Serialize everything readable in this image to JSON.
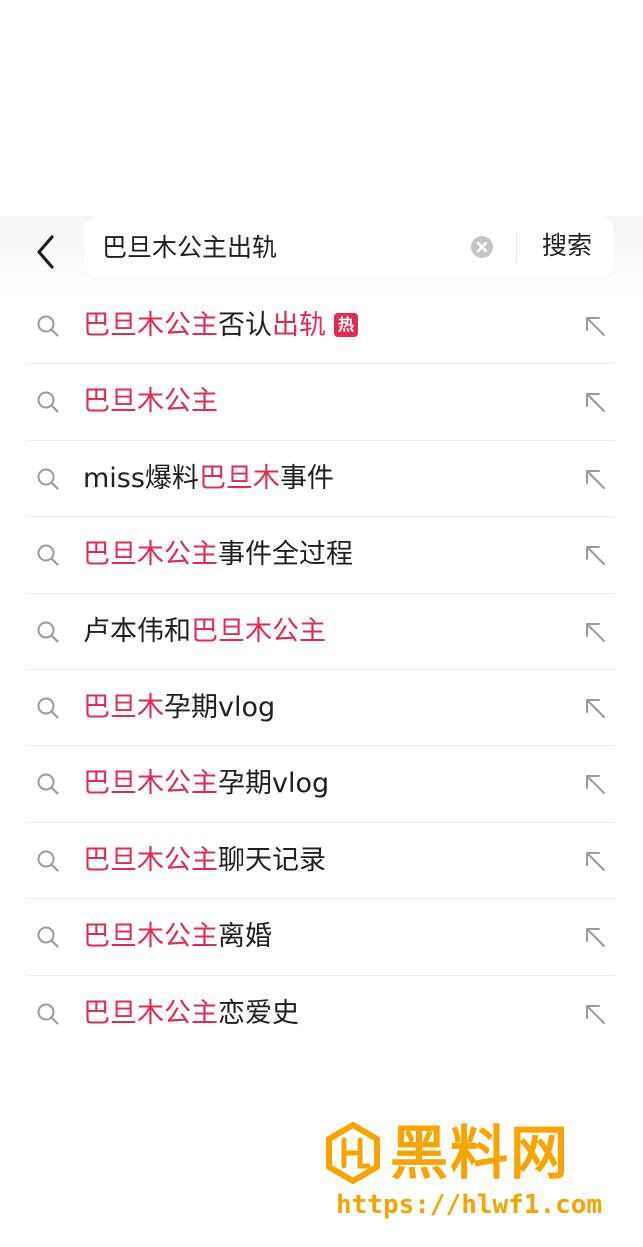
{
  "search": {
    "query": "巴旦木公主出轨",
    "button_label": "搜索"
  },
  "suggestions": [
    {
      "parts": [
        {
          "t": "巴旦木公主",
          "hl": true
        },
        {
          "t": "否认",
          "hl": false
        },
        {
          "t": "出轨",
          "hl": true
        }
      ],
      "badge": "热"
    },
    {
      "parts": [
        {
          "t": "巴旦木公主",
          "hl": true
        }
      ],
      "badge": ""
    },
    {
      "parts": [
        {
          "t": "miss爆料",
          "hl": false
        },
        {
          "t": "巴旦木",
          "hl": true
        },
        {
          "t": "事件",
          "hl": false
        }
      ],
      "badge": ""
    },
    {
      "parts": [
        {
          "t": "巴旦木公主",
          "hl": true
        },
        {
          "t": "事件全过程",
          "hl": false
        }
      ],
      "badge": ""
    },
    {
      "parts": [
        {
          "t": "卢本伟和",
          "hl": false
        },
        {
          "t": "巴旦木公主",
          "hl": true
        }
      ],
      "badge": ""
    },
    {
      "parts": [
        {
          "t": "巴旦木",
          "hl": true
        },
        {
          "t": "孕期vlog",
          "hl": false
        }
      ],
      "badge": ""
    },
    {
      "parts": [
        {
          "t": "巴旦木公主",
          "hl": true
        },
        {
          "t": "孕期vlog",
          "hl": false
        }
      ],
      "badge": ""
    },
    {
      "parts": [
        {
          "t": "巴旦木公主",
          "hl": true
        },
        {
          "t": "聊天记录",
          "hl": false
        }
      ],
      "badge": ""
    },
    {
      "parts": [
        {
          "t": "巴旦木公主",
          "hl": true
        },
        {
          "t": "离婚",
          "hl": false
        }
      ],
      "badge": ""
    },
    {
      "parts": [
        {
          "t": "巴旦木公主",
          "hl": true
        },
        {
          "t": "恋爱史",
          "hl": false
        }
      ],
      "badge": ""
    }
  ],
  "watermark": {
    "name": "黑料网",
    "url": "https://hlwf1.com"
  },
  "colors": {
    "highlight": "#e02b55",
    "watermark": "#f6a400"
  },
  "icons": {
    "back": "chevron-left-icon",
    "clear": "clear-circle-icon",
    "suggestion": "search-icon",
    "fill": "arrow-up-left-icon"
  }
}
